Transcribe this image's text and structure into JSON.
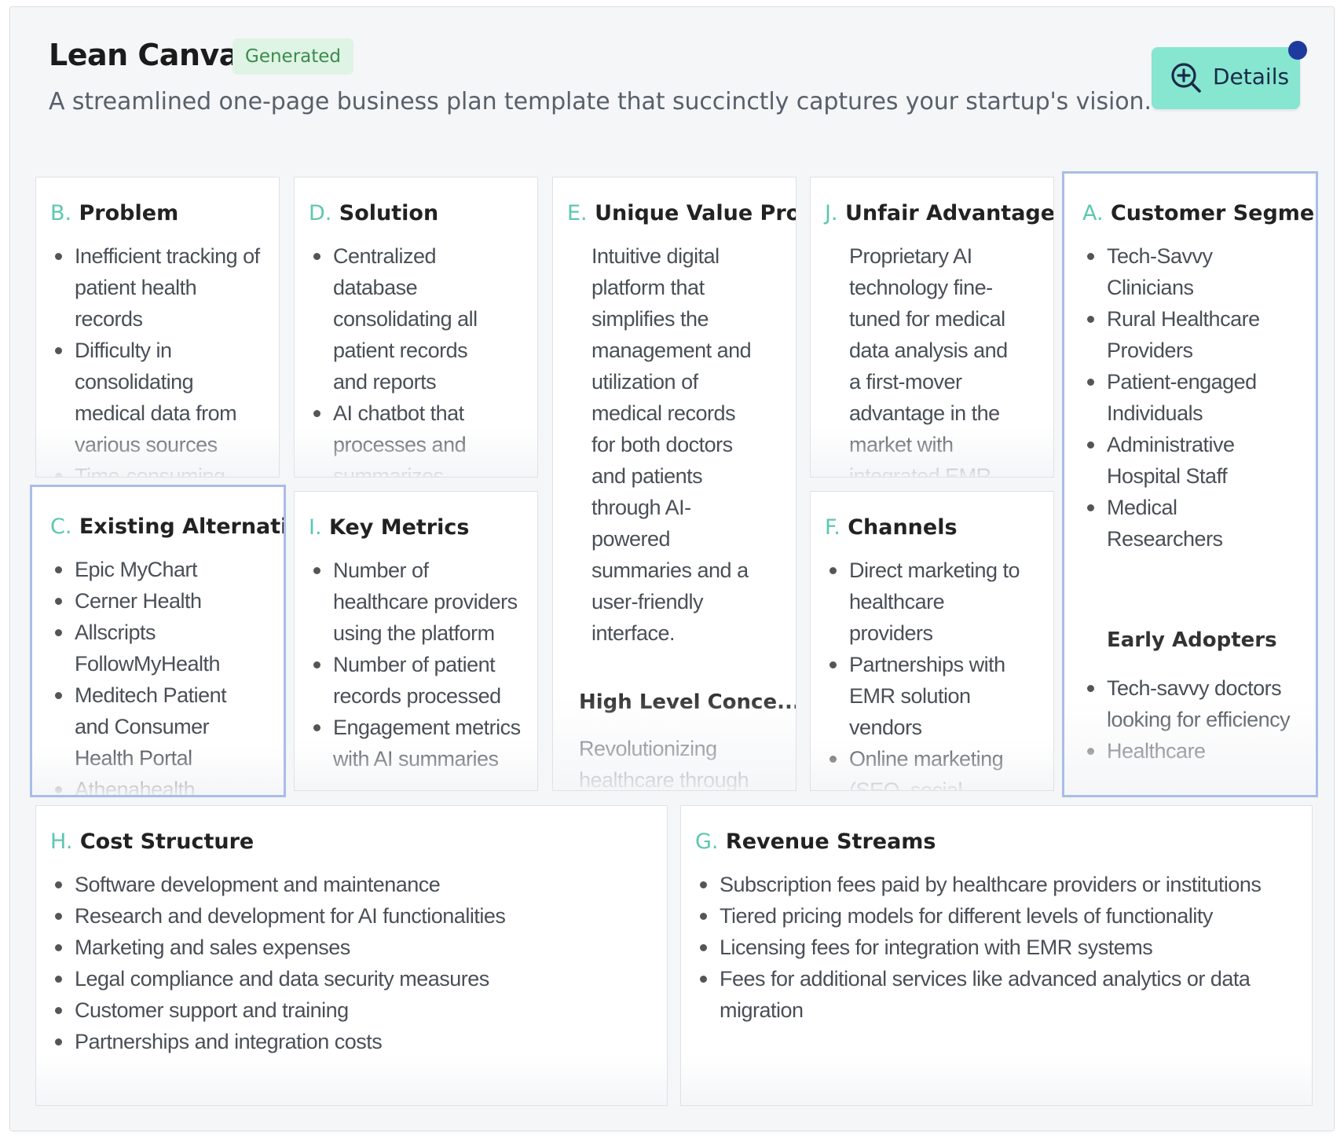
{
  "header": {
    "title": "Lean Canvas",
    "badge": "Generated",
    "subtitle": "A streamlined one-page business plan template that succinctly captures your startup's vision.",
    "details_button": "Details"
  },
  "sections": {
    "problem": {
      "letter": "B.",
      "title": "Problem",
      "items": [
        "Inefficient tracking of patient health records",
        "Difficulty in consolidating medical data from various sources",
        "Time-consuming"
      ]
    },
    "solution": {
      "letter": "D.",
      "title": "Solution",
      "items": [
        "Centralized database consolidating all patient records and reports",
        "AI chatbot that processes and summarizes"
      ]
    },
    "uvp": {
      "letter": "E.",
      "title": "Unique Value Prop.",
      "text": "Intuitive digital platform that simplifies the management and utilization of medical records for both doctors and patients through AI-powered summaries and a user-friendly interface.",
      "high_level_title": "High Level Conce...",
      "high_level_text": "Revolutionizing healthcare through"
    },
    "unfair": {
      "letter": "J.",
      "title": "Unfair Advantage",
      "text": "Proprietary AI technology fine-tuned for medical data analysis and a first-mover advantage in the market with integrated EMR"
    },
    "customers": {
      "letter": "A.",
      "title": "Customer Segme...",
      "items": [
        "Tech-Savvy Clinicians",
        "Rural Healthcare Providers",
        "Patient-engaged Individuals",
        "Administrative Hospital Staff",
        "Medical Researchers"
      ],
      "early_adopters_title": "Early Adopters",
      "early_adopters": [
        "Tech-savvy doctors looking for efficiency",
        "Healthcare"
      ]
    },
    "alternatives": {
      "letter": "C.",
      "title": "Existing Alternati...",
      "items": [
        "Epic MyChart",
        "Cerner Health",
        "Allscripts FollowMyHealth",
        "Meditech Patient and Consumer Health Portal",
        "Athenahealth"
      ]
    },
    "metrics": {
      "letter": "I.",
      "title": "Key Metrics",
      "items": [
        "Number of healthcare providers using the platform",
        "Number of patient records processed",
        "Engagement metrics with AI summaries"
      ]
    },
    "channels": {
      "letter": "F.",
      "title": "Channels",
      "items": [
        "Direct marketing to healthcare providers",
        "Partnerships with EMR solution vendors",
        "Online marketing (SEO, social media)"
      ]
    },
    "cost": {
      "letter": "H.",
      "title": "Cost Structure",
      "items": [
        "Software development and maintenance",
        "Research and development for AI functionalities",
        "Marketing and sales expenses",
        "Legal compliance and data security measures",
        "Customer support and training",
        "Partnerships and integration costs"
      ]
    },
    "revenue": {
      "letter": "G.",
      "title": "Revenue Streams",
      "items": [
        "Subscription fees paid by healthcare providers or institutions",
        "Tiered pricing models for different levels of functionality",
        "Licensing fees for integration with EMR systems",
        "Fees for additional services like advanced analytics or data migration"
      ]
    }
  },
  "colors": {
    "accent_letter": "#5cc7b0",
    "details_button": "#86e6cf",
    "badge_bg": "#dff4e4",
    "badge_text": "#3b8b4d",
    "selected_border": "#a8bde8",
    "notify_dot": "#1f3a9f"
  },
  "icons": {
    "details": "zoom-in-icon"
  }
}
